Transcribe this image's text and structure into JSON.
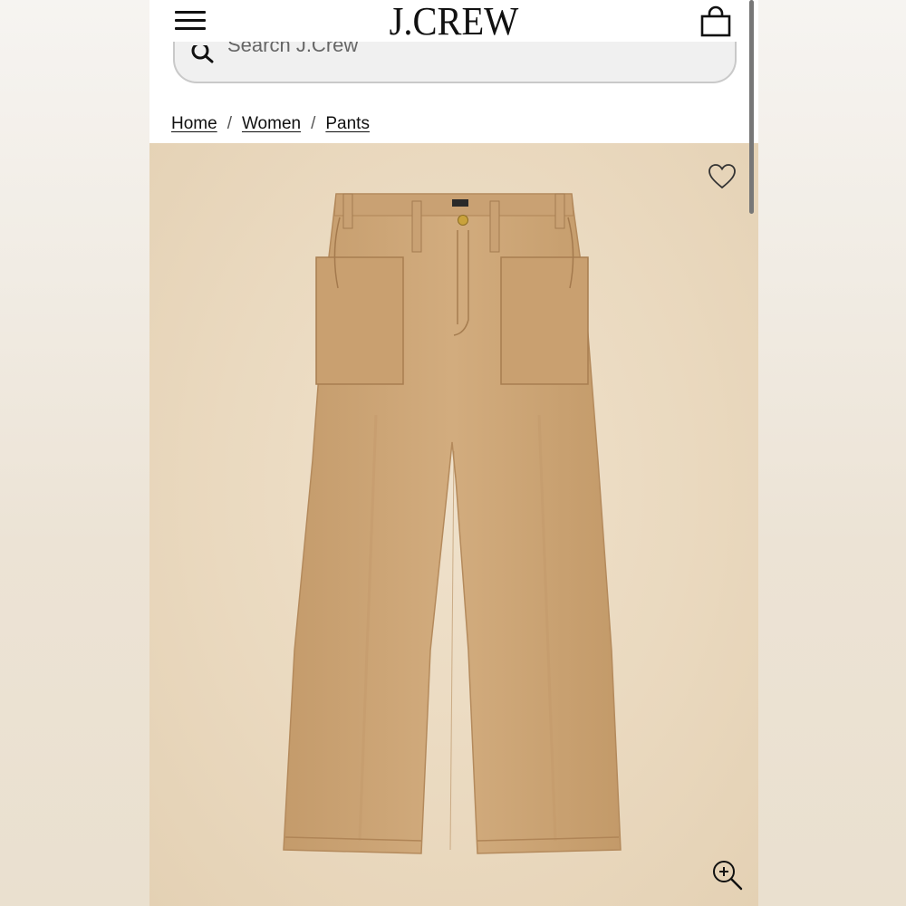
{
  "header": {
    "logo_text": "J.CREW",
    "menu_icon": "hamburger-menu-icon",
    "bag_icon": "shopping-bag-icon"
  },
  "search": {
    "placeholder": "Search J.Crew",
    "icon": "search-icon"
  },
  "breadcrumb": {
    "items": [
      {
        "label": "Home"
      },
      {
        "label": "Women"
      },
      {
        "label": "Pants"
      }
    ],
    "separator": "/"
  },
  "product": {
    "image_alt": "Camel wide-leg utility pants",
    "favorite_icon": "heart-icon",
    "zoom_icon": "zoom-in-icon",
    "colors": {
      "background": "#e9d8be",
      "fabric": "#cca577",
      "fabric_shadow": "#b58b5c",
      "button": "#c9a23c"
    }
  }
}
